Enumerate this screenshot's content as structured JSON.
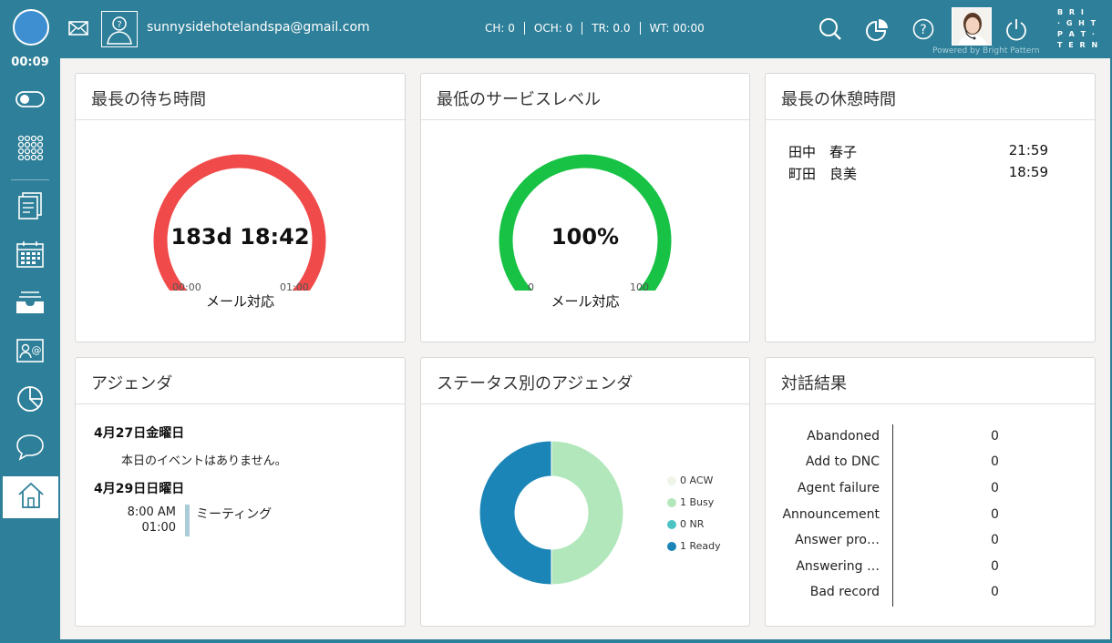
{
  "header": {
    "timer": "00:09",
    "email": "sunnysidehotelandspa@gmail.com",
    "metrics": [
      "CH: 0",
      "OCH: 0",
      "TR: 0.0",
      "WT: 00:00"
    ],
    "powered_by": "Powered by Bright Pattern",
    "logo_lines": [
      "B R I",
      "· G H T",
      "P A T ·",
      "T E R N"
    ],
    "icons": [
      "mail-icon",
      "unknown-user-icon",
      "search-icon",
      "pie-chart-icon",
      "help-icon",
      "agent-avatar",
      "power-icon"
    ],
    "status_color": "#3d8fd1"
  },
  "sidebar": {
    "items": [
      "toggle-icon",
      "dialpad-icon",
      "forms-icon",
      "calendar-icon",
      "inbox-icon",
      "contacts-icon",
      "reports-icon",
      "chat-icon",
      "home-icon"
    ],
    "active": "home-icon"
  },
  "panels": {
    "longest_wait": {
      "title": "最長の待ち時間",
      "value": "183d 18:42",
      "min": "00:00",
      "max": "01:00",
      "label": "メール対応",
      "color": "#f04a4a"
    },
    "min_service": {
      "title": "最低のサービスレベル",
      "value": "100%",
      "min": "0",
      "max": "100",
      "label": "メール対応",
      "color": "#17c244"
    },
    "longest_break": {
      "title": "最長の休憩時間",
      "rows": [
        {
          "name": "田中　春子",
          "time": "21:59"
        },
        {
          "name": "町田　良美",
          "time": "18:59"
        }
      ]
    },
    "agenda": {
      "title": "アジェンダ",
      "day1": "4月27日金曜日",
      "no_events": "本日のイベントはありません。",
      "day2": "4月29日日曜日",
      "event_start": "8:00 AM",
      "event_duration": "01:00",
      "event_title": "ミーティング"
    },
    "status_agenda": {
      "title": "ステータス別のアジェンダ",
      "legend": [
        {
          "label": "0 ACW",
          "color": "#eef5e8"
        },
        {
          "label": "1 Busy",
          "color": "#b2e7bc"
        },
        {
          "label": "0 NR",
          "color": "#4cc3c3"
        },
        {
          "label": "1 Ready",
          "color": "#1a85b6"
        }
      ]
    },
    "results": {
      "title": "対話結果",
      "rows": [
        {
          "label": "Abandoned",
          "value": "0"
        },
        {
          "label": "Add to DNC",
          "value": "0"
        },
        {
          "label": "Agent failure",
          "value": "0"
        },
        {
          "label": "Announcement",
          "value": "0"
        },
        {
          "label": "Answer pro…",
          "value": "0"
        },
        {
          "label": "Answering …",
          "value": "0"
        },
        {
          "label": "Bad record",
          "value": "0"
        }
      ]
    }
  },
  "chart_data": {
    "type": "pie",
    "title": "ステータス別のアジェンダ",
    "categories": [
      "ACW",
      "Busy",
      "NR",
      "Ready"
    ],
    "values": [
      0,
      1,
      0,
      1
    ],
    "colors": [
      "#eef5e8",
      "#b2e7bc",
      "#4cc3c3",
      "#1a85b6"
    ],
    "legend": "right"
  }
}
